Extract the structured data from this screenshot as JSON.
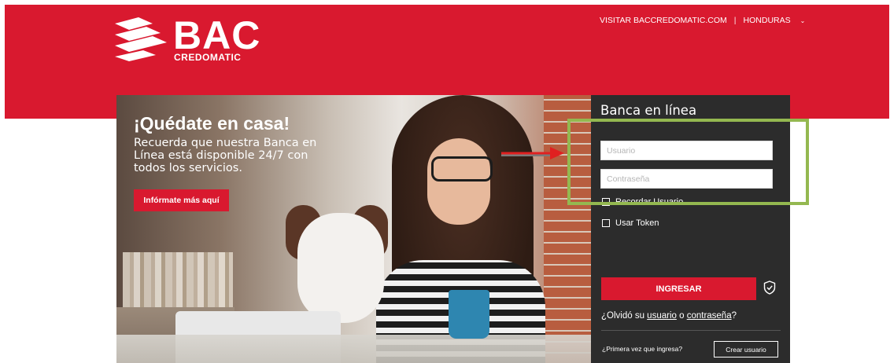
{
  "brand": {
    "logo_text": "BAC",
    "logo_subtext": "CREDOMATIC",
    "color_red": "#d9192f",
    "color_dark": "#2c2c2c",
    "highlight_green": "#94b850"
  },
  "topnav": {
    "visit_link": "VISITAR BACCREDOMATIC.COM",
    "country": "HONDURAS",
    "separator": "|"
  },
  "hero": {
    "title": "¡Quédate en casa!",
    "text": "Recuerda que nuestra Banca en Línea está disponible 24/7 con todos los servicios.",
    "button_label": "Infórmate más aquí"
  },
  "login": {
    "title": "Banca en línea",
    "username_placeholder": "Usuario",
    "password_placeholder": "Contraseña",
    "remember_label": "Recordar Usuario",
    "token_label": "Usar Token",
    "submit_label": "INGRESAR",
    "forgot_prefix": "¿Olvidó su",
    "forgot_user": "usuario",
    "forgot_or": "o",
    "forgot_password": "contraseña",
    "forgot_suffix": "?",
    "first_time_text": "¿Primera vez que ingresa?",
    "create_user_label": "Crear usuario"
  },
  "icons": {
    "logo": "bac-logo-icon",
    "shield": "shield-check-icon",
    "chevron": "chevron-down-icon",
    "arrow": "arrow-right-icon"
  }
}
